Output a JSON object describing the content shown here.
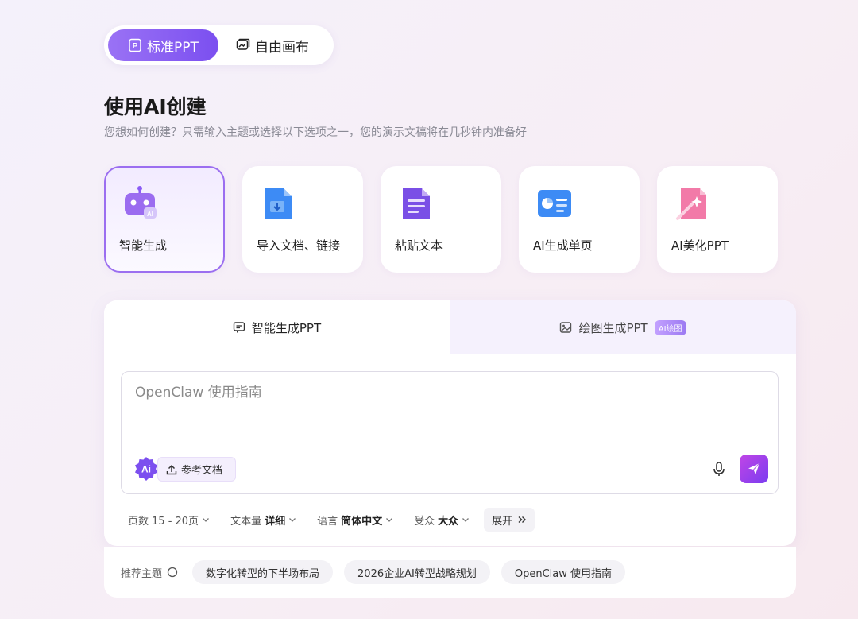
{
  "mode_switch": {
    "standard_label": "标准PPT",
    "canvas_label": "自由画布"
  },
  "header": {
    "title": "使用AI创建",
    "subtitle": "您想如何创建？只需输入主题或选择以下选项之一，您的演示文稿将在几秒钟内准备好"
  },
  "cards": [
    {
      "label": "智能生成",
      "icon": "robot-icon"
    },
    {
      "label": "导入文档、链接",
      "icon": "import-doc-icon"
    },
    {
      "label": "粘贴文本",
      "icon": "paste-text-icon"
    },
    {
      "label": "AI生成单页",
      "icon": "single-page-icon"
    },
    {
      "label": "AI美化PPT",
      "icon": "beautify-icon"
    }
  ],
  "tabs": {
    "smart": "智能生成PPT",
    "draw": "绘图生成PPT",
    "draw_badge": "AI绘图"
  },
  "input": {
    "placeholder": "OpenClaw 使用指南",
    "ai_badge": "Ai",
    "reference_label": "参考文档"
  },
  "options": {
    "pages_label": "页数",
    "pages_value": "15 - 20页",
    "text_label": "文本量",
    "text_value": "详细",
    "lang_label": "语言",
    "lang_value": "简体中文",
    "audience_label": "受众",
    "audience_value": "大众",
    "expand_label": "展开"
  },
  "recommend": {
    "label": "推荐主题",
    "chips": [
      "数字化转型的下半场布局",
      "2026企业AI转型战略规划",
      "OpenClaw 使用指南"
    ]
  },
  "colors": {
    "accent": "#8b5cf6",
    "send": "#a03fe8"
  }
}
